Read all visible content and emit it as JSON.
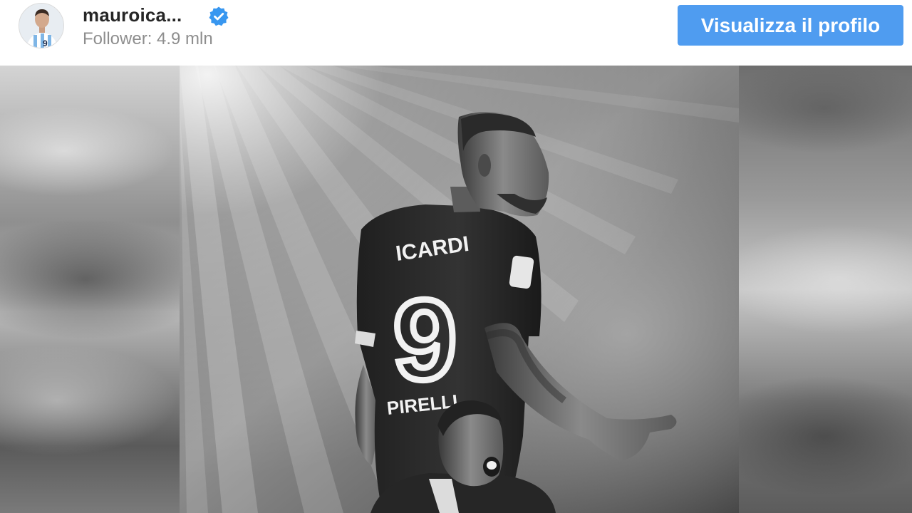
{
  "header": {
    "username": "mauroica...",
    "verified": true,
    "followers_label": "Follower: 4.9 mln",
    "profile_button_label": "Visualizza il profilo"
  },
  "post": {
    "jersey_name": "ICARDI",
    "jersey_number": "9",
    "sponsor": "PIRELLI"
  },
  "colors": {
    "accent": "#4f9cf0",
    "verified": "#3897f0",
    "username": "#262626",
    "secondary_text": "#8e8e8e"
  }
}
